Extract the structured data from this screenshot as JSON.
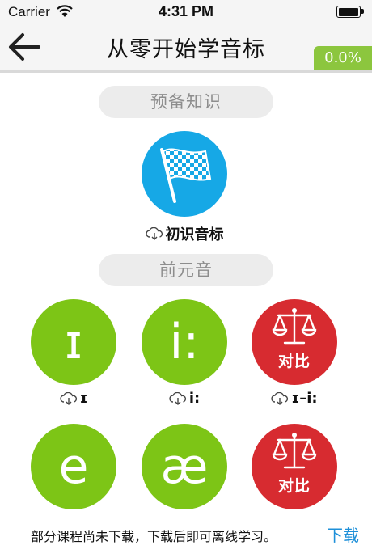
{
  "status": {
    "carrier": "Carrier",
    "time": "4:31 PM"
  },
  "nav": {
    "title": "从零开始学音标",
    "progress": "0.0%"
  },
  "sections": [
    {
      "title": "预备知识"
    },
    {
      "title": "前元音"
    }
  ],
  "items": {
    "intro": {
      "label": "初识音标"
    },
    "i_short": {
      "symbol": "ɪ",
      "label": "ɪ"
    },
    "i_long": {
      "symbol": "i:",
      "label": "i:"
    },
    "compare1": {
      "text": "对比",
      "label": "ɪ–i:"
    },
    "e": {
      "symbol": "e"
    },
    "ae": {
      "symbol": "æ"
    },
    "compare2": {
      "text": "对比"
    }
  },
  "bottom": {
    "message": "部分课程尚未下载，下载后即可离线学习。",
    "download": "下载"
  },
  "colors": {
    "green": "#7dc516",
    "blue": "#16a8e6",
    "red": "#d72b30",
    "progress": "#8cc63e",
    "link": "#1e90d9"
  }
}
